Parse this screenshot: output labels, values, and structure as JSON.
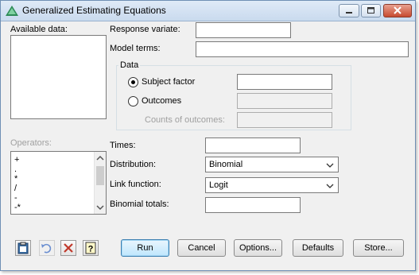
{
  "window": {
    "title": "Generalized Estimating Equations",
    "app_icon": "genstat-triangle-icon"
  },
  "available_data": {
    "label": "Available data:"
  },
  "response_variate": {
    "label": "Response variate:",
    "value": ""
  },
  "model_terms": {
    "label": "Model terms:",
    "value": ""
  },
  "data_group": {
    "label": "Data",
    "subject_factor_label": "Subject factor",
    "subject_factor_value": "",
    "outcomes_label": "Outcomes",
    "outcomes_value": "",
    "counts_label": "Counts of outcomes:",
    "counts_value": "",
    "selected": "Subject factor"
  },
  "operators": {
    "label": "Operators:",
    "items": [
      "+",
      ".",
      "*",
      "/",
      "-",
      "-*"
    ]
  },
  "times": {
    "label": "Times:",
    "value": ""
  },
  "distribution": {
    "label": "Distribution:",
    "selected": "Binomial"
  },
  "link_function": {
    "label": "Link function:",
    "selected": "Logit"
  },
  "binomial_totals": {
    "label": "Binomial totals:",
    "value": ""
  },
  "buttons": {
    "run": "Run",
    "cancel": "Cancel",
    "options": "Options...",
    "defaults": "Defaults",
    "store": "Store..."
  },
  "toolbar_icons": [
    "clipboard-icon",
    "undo-icon",
    "clear-icon",
    "help-icon"
  ],
  "colors": {
    "accent": "#3c7fb1",
    "titlebar": "#c9daee",
    "close": "#c74a2f"
  }
}
